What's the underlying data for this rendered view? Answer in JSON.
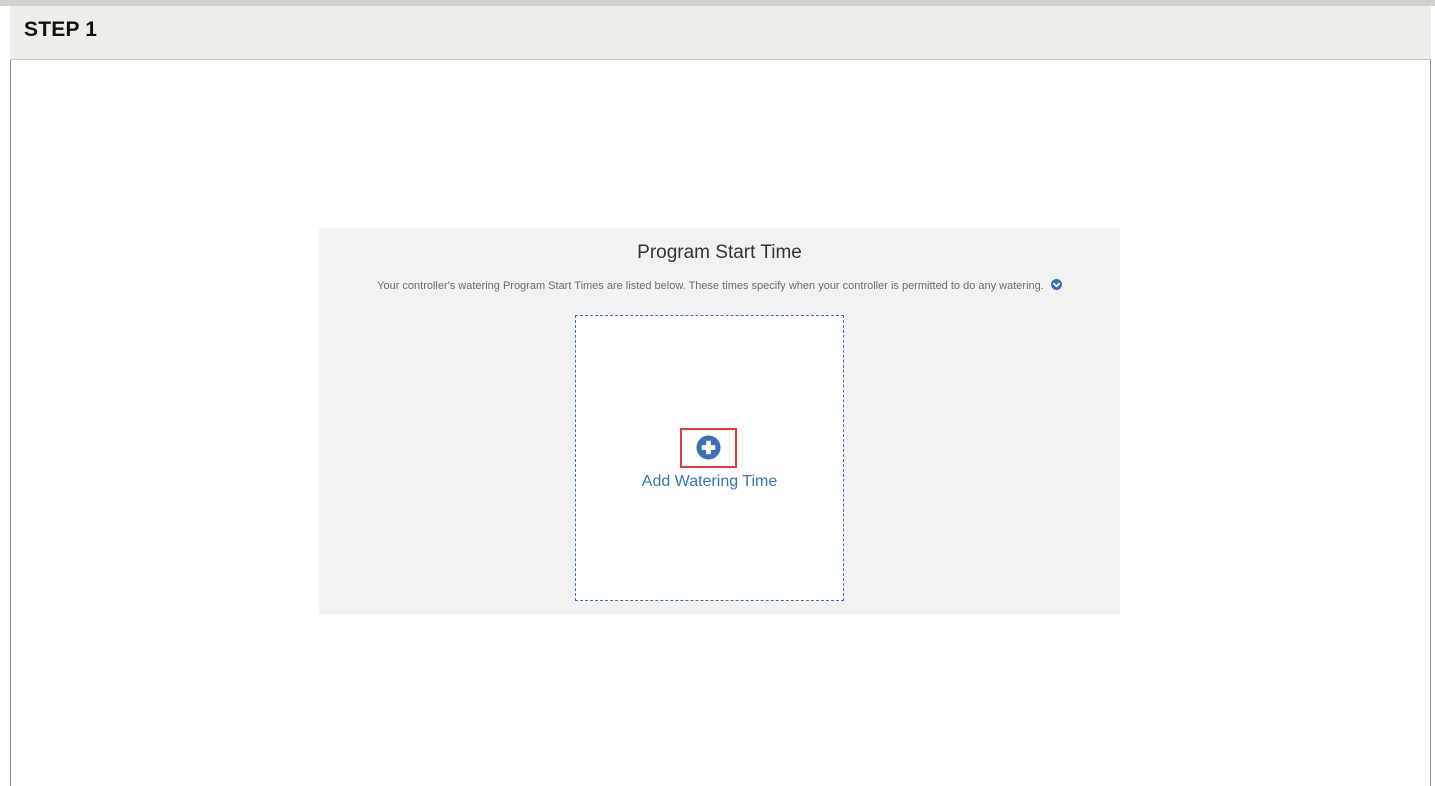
{
  "step": {
    "title": "STEP 1"
  },
  "program": {
    "title": "Program Start Time",
    "description": "Your controller's watering Program Start Times are listed below. These times specify when your controller is permitted to do any watering.",
    "info_icon": "chevron-down-circle-icon",
    "add_button": {
      "label": "Add Watering Time",
      "icon": "plus-circle-icon"
    }
  },
  "colors": {
    "accent": "#3d6fb6",
    "highlight": "#e03c3c",
    "header_bg": "#efedea",
    "panel_bg": "#f2f2f2"
  }
}
